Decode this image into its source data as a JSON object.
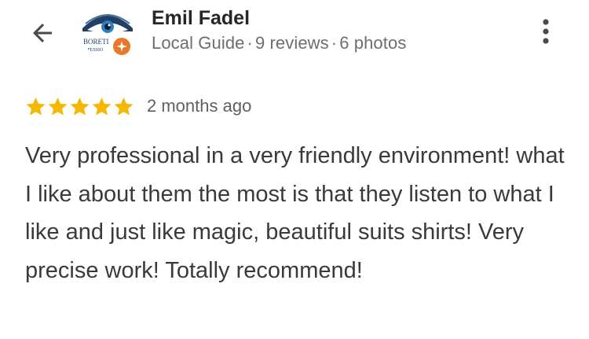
{
  "reviewer": {
    "name": "Emil Fadel",
    "role": "Local Guide",
    "reviews": "9 reviews",
    "photos": "6 photos",
    "separator": "·",
    "avatar_text_top": "BORETI",
    "avatar_text_bottom": "OFESSIO"
  },
  "review": {
    "rating": 5,
    "max_rating": 5,
    "date": "2 months ago",
    "text": "Very professional in a very friendly environment! what I like about them the most is that they listen to what I like and just like magic, beautiful suits shirts! Very precise work! Totally recommend!"
  },
  "icons": {
    "back": "arrow-back-icon",
    "more": "more-vert-icon",
    "star": "star-icon",
    "badge": "local-guide-badge-icon"
  },
  "colors": {
    "star": "#f5b800",
    "badge": "#e8792a",
    "name": "#262626",
    "meta": "#6e6e6e",
    "body_text": "#3a3a3a"
  }
}
